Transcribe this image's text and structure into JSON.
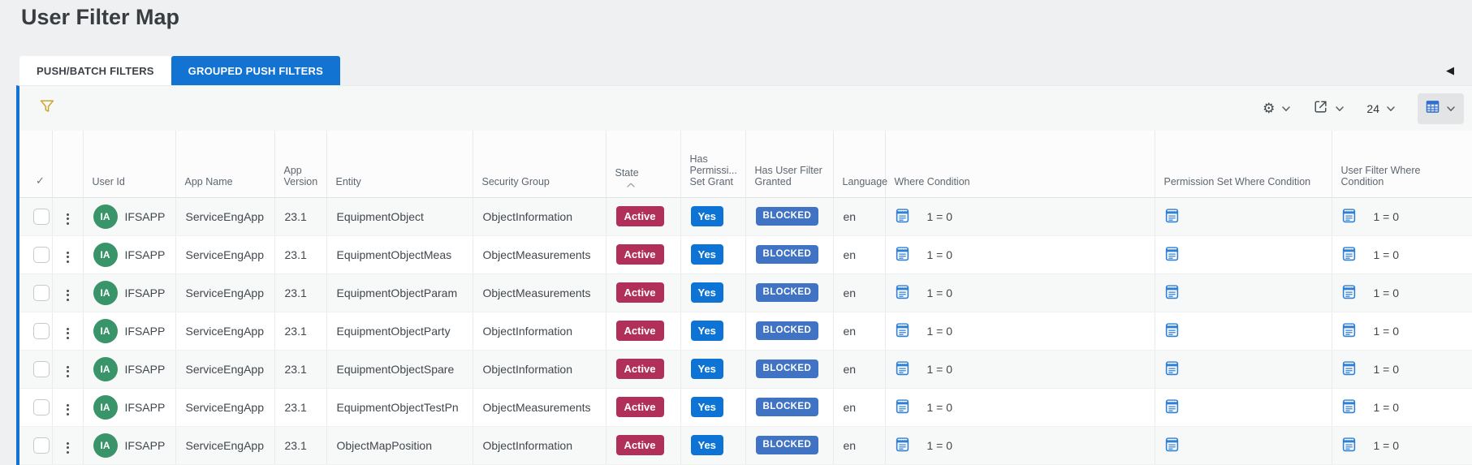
{
  "page": {
    "title": "User Filter Map",
    "collapse_glyph": "◀"
  },
  "tabs": [
    {
      "label": "PUSH/BATCH FILTERS",
      "active": false
    },
    {
      "label": "GROUPED PUSH FILTERS",
      "active": true
    }
  ],
  "toolbar": {
    "filter_icon": "funnel-icon",
    "settings_glyph": "⚙",
    "export_icon": "share-icon",
    "page_size_value": "24",
    "view_icon": "table-grid-icon"
  },
  "table": {
    "select_all_glyph": "✓",
    "headers": {
      "user_id": "User Id",
      "app_name": "App Name",
      "app_version": "App Version",
      "entity": "Entity",
      "security_group": "Security Group",
      "state": "State",
      "has_permission_set_grant": "Has Permissi... Set Grant",
      "has_user_filter_granted": "Has User Filter Granted",
      "language": "Language",
      "where_condition": "Where Condition",
      "permission_set_where_condition": "Permission Set Where Condition",
      "user_filter_where_condition": "User Filter Where Condition"
    },
    "rows": [
      {
        "avatar": "IA",
        "user_id": "IFSAPP",
        "app_name": "ServiceEngApp",
        "app_version": "23.1",
        "entity": "EquipmentObject",
        "security_group": "ObjectInformation",
        "state": "Active",
        "has_permission_set_grant": "Yes",
        "has_user_filter_granted": "BLOCKED",
        "language": "en",
        "where_condition": "1 = 0",
        "permission_set_where_condition": "",
        "user_filter_where_condition": "1 = 0"
      },
      {
        "avatar": "IA",
        "user_id": "IFSAPP",
        "app_name": "ServiceEngApp",
        "app_version": "23.1",
        "entity": "EquipmentObjectMeas",
        "security_group": "ObjectMeasurements",
        "state": "Active",
        "has_permission_set_grant": "Yes",
        "has_user_filter_granted": "BLOCKED",
        "language": "en",
        "where_condition": "1 = 0",
        "permission_set_where_condition": "",
        "user_filter_where_condition": "1 = 0"
      },
      {
        "avatar": "IA",
        "user_id": "IFSAPP",
        "app_name": "ServiceEngApp",
        "app_version": "23.1",
        "entity": "EquipmentObjectParam",
        "security_group": "ObjectMeasurements",
        "state": "Active",
        "has_permission_set_grant": "Yes",
        "has_user_filter_granted": "BLOCKED",
        "language": "en",
        "where_condition": "1 = 0",
        "permission_set_where_condition": "",
        "user_filter_where_condition": "1 = 0"
      },
      {
        "avatar": "IA",
        "user_id": "IFSAPP",
        "app_name": "ServiceEngApp",
        "app_version": "23.1",
        "entity": "EquipmentObjectParty",
        "security_group": "ObjectInformation",
        "state": "Active",
        "has_permission_set_grant": "Yes",
        "has_user_filter_granted": "BLOCKED",
        "language": "en",
        "where_condition": "1 = 0",
        "permission_set_where_condition": "",
        "user_filter_where_condition": "1 = 0"
      },
      {
        "avatar": "IA",
        "user_id": "IFSAPP",
        "app_name": "ServiceEngApp",
        "app_version": "23.1",
        "entity": "EquipmentObjectSpare",
        "security_group": "ObjectInformation",
        "state": "Active",
        "has_permission_set_grant": "Yes",
        "has_user_filter_granted": "BLOCKED",
        "language": "en",
        "where_condition": "1 = 0",
        "permission_set_where_condition": "",
        "user_filter_where_condition": "1 = 0"
      },
      {
        "avatar": "IA",
        "user_id": "IFSAPP",
        "app_name": "ServiceEngApp",
        "app_version": "23.1",
        "entity": "EquipmentObjectTestPn",
        "security_group": "ObjectMeasurements",
        "state": "Active",
        "has_permission_set_grant": "Yes",
        "has_user_filter_granted": "BLOCKED",
        "language": "en",
        "where_condition": "1 = 0",
        "permission_set_where_condition": "",
        "user_filter_where_condition": "1 = 0"
      },
      {
        "avatar": "IA",
        "user_id": "IFSAPP",
        "app_name": "ServiceEngApp",
        "app_version": "23.1",
        "entity": "ObjectMapPosition",
        "security_group": "ObjectInformation",
        "state": "Active",
        "has_permission_set_grant": "Yes",
        "has_user_filter_granted": "BLOCKED",
        "language": "en",
        "where_condition": "1 = 0",
        "permission_set_where_condition": "",
        "user_filter_where_condition": "1 = 0"
      }
    ]
  },
  "colors": {
    "accent-blue": "#1273d2",
    "badge-red": "#b13059",
    "badge-blue": "#0d74d6",
    "badge-steel": "#4173c4",
    "avatar-green": "#3a9469",
    "icon-blue": "#2f80d4",
    "funnel-gold": "#c9a72c"
  }
}
